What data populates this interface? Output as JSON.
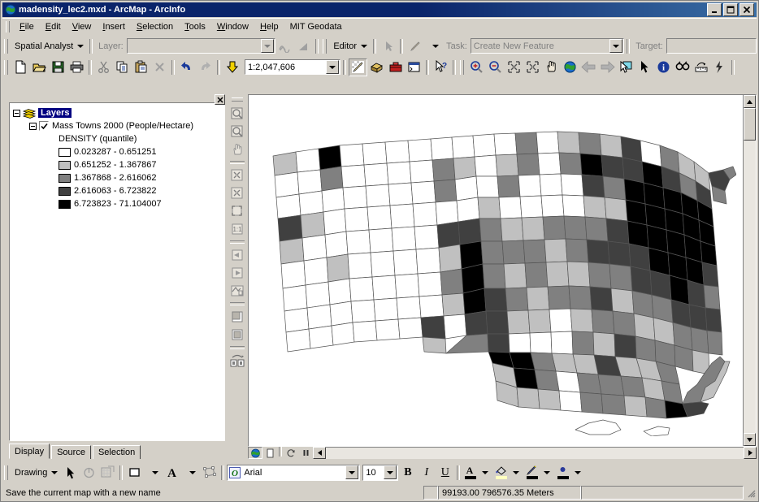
{
  "window": {
    "title": "madensity_lec2.mxd - ArcMap - ArcInfo",
    "icon": "arcmap-globe-icon",
    "minimize_label": "_",
    "maximize_label": "□",
    "close_label": "×"
  },
  "menu": {
    "items": [
      {
        "label": "File",
        "accel": "F"
      },
      {
        "label": "Edit",
        "accel": "E"
      },
      {
        "label": "View",
        "accel": "V"
      },
      {
        "label": "Insert",
        "accel": "I"
      },
      {
        "label": "Selection",
        "accel": "S"
      },
      {
        "label": "Tools",
        "accel": "T"
      },
      {
        "label": "Window",
        "accel": "W"
      },
      {
        "label": "Help",
        "accel": "H"
      },
      {
        "label": "MIT Geodata",
        "accel": ""
      }
    ]
  },
  "spatial_analyst_toolbar": {
    "menu_label": "Spatial Analyst",
    "layer_label": "Layer:",
    "layer_value": "",
    "layer_placeholder": ""
  },
  "editor_toolbar": {
    "menu_label": "Editor",
    "task_label": "Task:",
    "task_value": "Create New Feature",
    "target_label": "Target:",
    "target_value": ""
  },
  "standard_toolbar": {
    "scale_label": "1:2,047,606",
    "buttons": [
      {
        "name": "new-map-button",
        "title": "New Map"
      },
      {
        "name": "open-button",
        "title": "Open"
      },
      {
        "name": "save-button",
        "title": "Save"
      },
      {
        "name": "print-button",
        "title": "Print"
      },
      {
        "name": "cut-button",
        "title": "Cut"
      },
      {
        "name": "copy-button",
        "title": "Copy"
      },
      {
        "name": "paste-button",
        "title": "Paste"
      },
      {
        "name": "delete-button",
        "title": "Delete"
      },
      {
        "name": "undo-button",
        "title": "Undo"
      },
      {
        "name": "redo-button",
        "title": "Redo"
      },
      {
        "name": "add-data-button",
        "title": "Add Data"
      }
    ]
  },
  "tools_toolbar": {
    "buttons": [
      {
        "name": "zoom-in-tool",
        "title": "Zoom In"
      },
      {
        "name": "zoom-out-tool",
        "title": "Zoom Out"
      },
      {
        "name": "fixed-zoom-in-tool",
        "title": "Fixed Zoom In"
      },
      {
        "name": "fixed-zoom-out-tool",
        "title": "Fixed Zoom Out"
      },
      {
        "name": "pan-tool",
        "title": "Pan"
      },
      {
        "name": "full-extent-tool",
        "title": "Full Extent"
      },
      {
        "name": "back-extent-tool",
        "title": "Go Back To Previous Extent"
      },
      {
        "name": "forward-extent-tool",
        "title": "Go To Next Extent"
      },
      {
        "name": "select-features-tool",
        "title": "Select Features"
      },
      {
        "name": "select-elements-tool",
        "title": "Select Elements"
      },
      {
        "name": "identify-tool",
        "title": "Identify"
      },
      {
        "name": "find-tool",
        "title": "Find"
      },
      {
        "name": "measure-tool",
        "title": "Measure"
      },
      {
        "name": "hyperlink-tool",
        "title": "Hyperlink"
      }
    ]
  },
  "toc": {
    "close_label": "×",
    "root_label": "Layers",
    "layer_label": "Mass Towns 2000 (People/Hectare)",
    "layer_checked": true,
    "field_label": "DENSITY (quantile)",
    "legend": [
      {
        "color": "#ffffff",
        "label": "0.023287 - 0.651251"
      },
      {
        "color": "#c0c0c0",
        "label": "0.651252 - 1.367867"
      },
      {
        "color": "#808080",
        "label": "1.367868 - 2.616062"
      },
      {
        "color": "#404040",
        "label": "2.616063 - 6.723822"
      },
      {
        "color": "#000000",
        "label": "6.723823 - 71.104007"
      }
    ],
    "tabs": [
      {
        "label": "Display",
        "active": true
      },
      {
        "label": "Source",
        "active": false
      },
      {
        "label": "Selection",
        "active": false
      }
    ]
  },
  "map": {
    "data_view_title": "Data View",
    "layout_view_title": "Layout View",
    "refresh_title": "Refresh",
    "pause_title": "Pause Drawing"
  },
  "drawing_toolbar": {
    "menu_label": "Drawing",
    "font_name": "Arial",
    "font_size": "10",
    "bold_label": "B",
    "italic_label": "I",
    "underline_label": "U",
    "font_color_name": "font-color-button",
    "fill_color_name": "fill-color-button",
    "line_color_name": "line-color-button",
    "marker_color_name": "marker-color-button"
  },
  "status": {
    "message": "Save the current map with a new name",
    "coordinates": "99193.00  796576.35 Meters",
    "extra": ""
  },
  "chart_data": {
    "type": "map",
    "title": "Mass Towns 2000 (People/Hectare)",
    "classification": "DENSITY (quantile)",
    "class_count": 5,
    "scale": "1:2,047,606",
    "classes": [
      {
        "min": 0.023287,
        "max": 0.651251,
        "color": "#ffffff"
      },
      {
        "min": 0.651252,
        "max": 1.367867,
        "color": "#c0c0c0"
      },
      {
        "min": 1.367868,
        "max": 2.616062,
        "color": "#808080"
      },
      {
        "min": 2.616063,
        "max": 6.723822,
        "color": "#404040"
      },
      {
        "min": 6.723823,
        "max": 71.104007,
        "color": "#000000"
      }
    ]
  }
}
